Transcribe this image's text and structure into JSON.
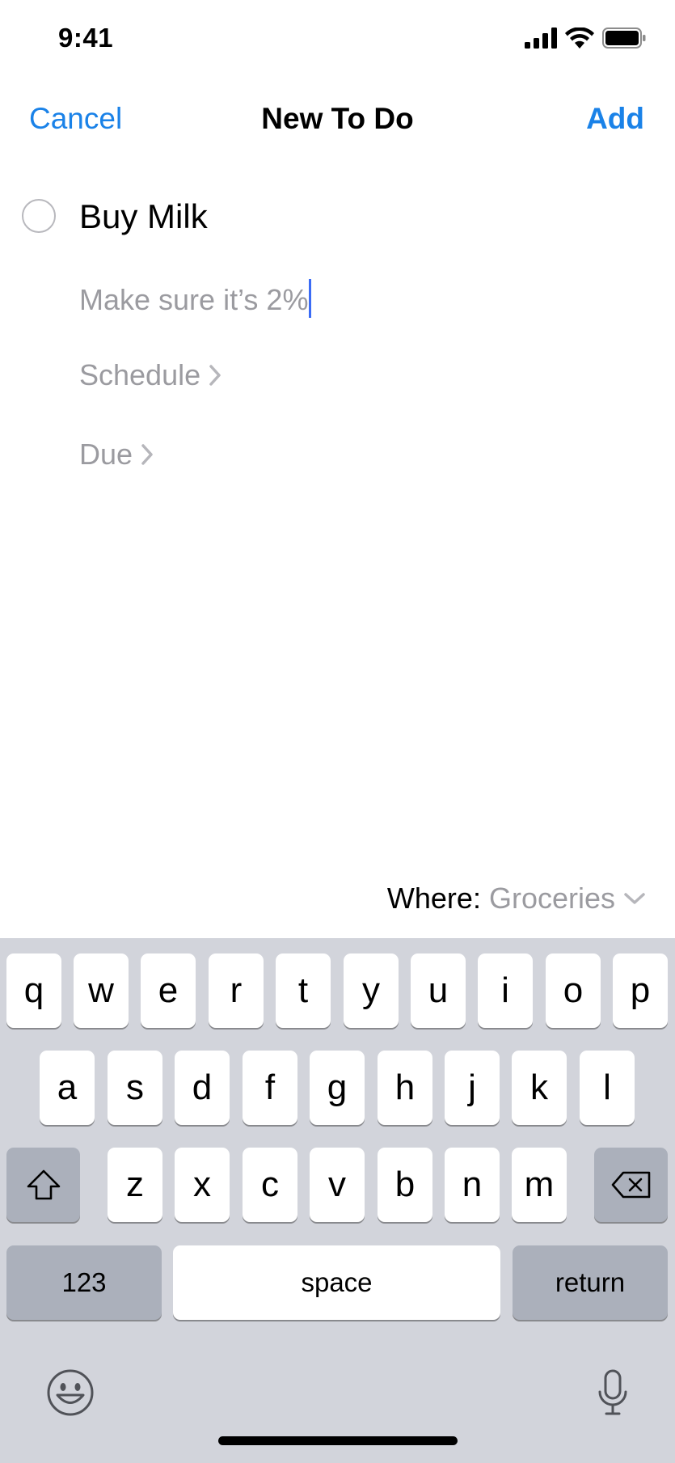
{
  "status_bar": {
    "time": "9:41",
    "signal_icon": "cellular-signal-icon",
    "wifi_icon": "wifi-icon",
    "battery_icon": "battery-icon"
  },
  "nav": {
    "cancel_label": "Cancel",
    "title": "New To Do",
    "add_label": "Add"
  },
  "form": {
    "todo_title": "Buy Milk",
    "notes_value": "Make sure it’s 2%",
    "schedule_label": "Schedule",
    "due_label": "Due",
    "where_label": "Where:",
    "where_value": "Groceries"
  },
  "colors": {
    "accent": "#1a82e8",
    "placeholder": "#9b9ba0",
    "caret": "#3b6cf5",
    "keyboard_bg": "#d2d4db"
  },
  "keyboard": {
    "row1": [
      "q",
      "w",
      "e",
      "r",
      "t",
      "y",
      "u",
      "i",
      "o",
      "p"
    ],
    "row2": [
      "a",
      "s",
      "d",
      "f",
      "g",
      "h",
      "j",
      "k",
      "l"
    ],
    "row3": [
      "z",
      "x",
      "c",
      "v",
      "b",
      "n",
      "m"
    ],
    "numbers_label": "123",
    "space_label": "space",
    "return_label": "return",
    "shift_icon": "shift-icon",
    "delete_icon": "delete-icon",
    "emoji_icon": "emoji-icon",
    "mic_icon": "microphone-icon"
  }
}
